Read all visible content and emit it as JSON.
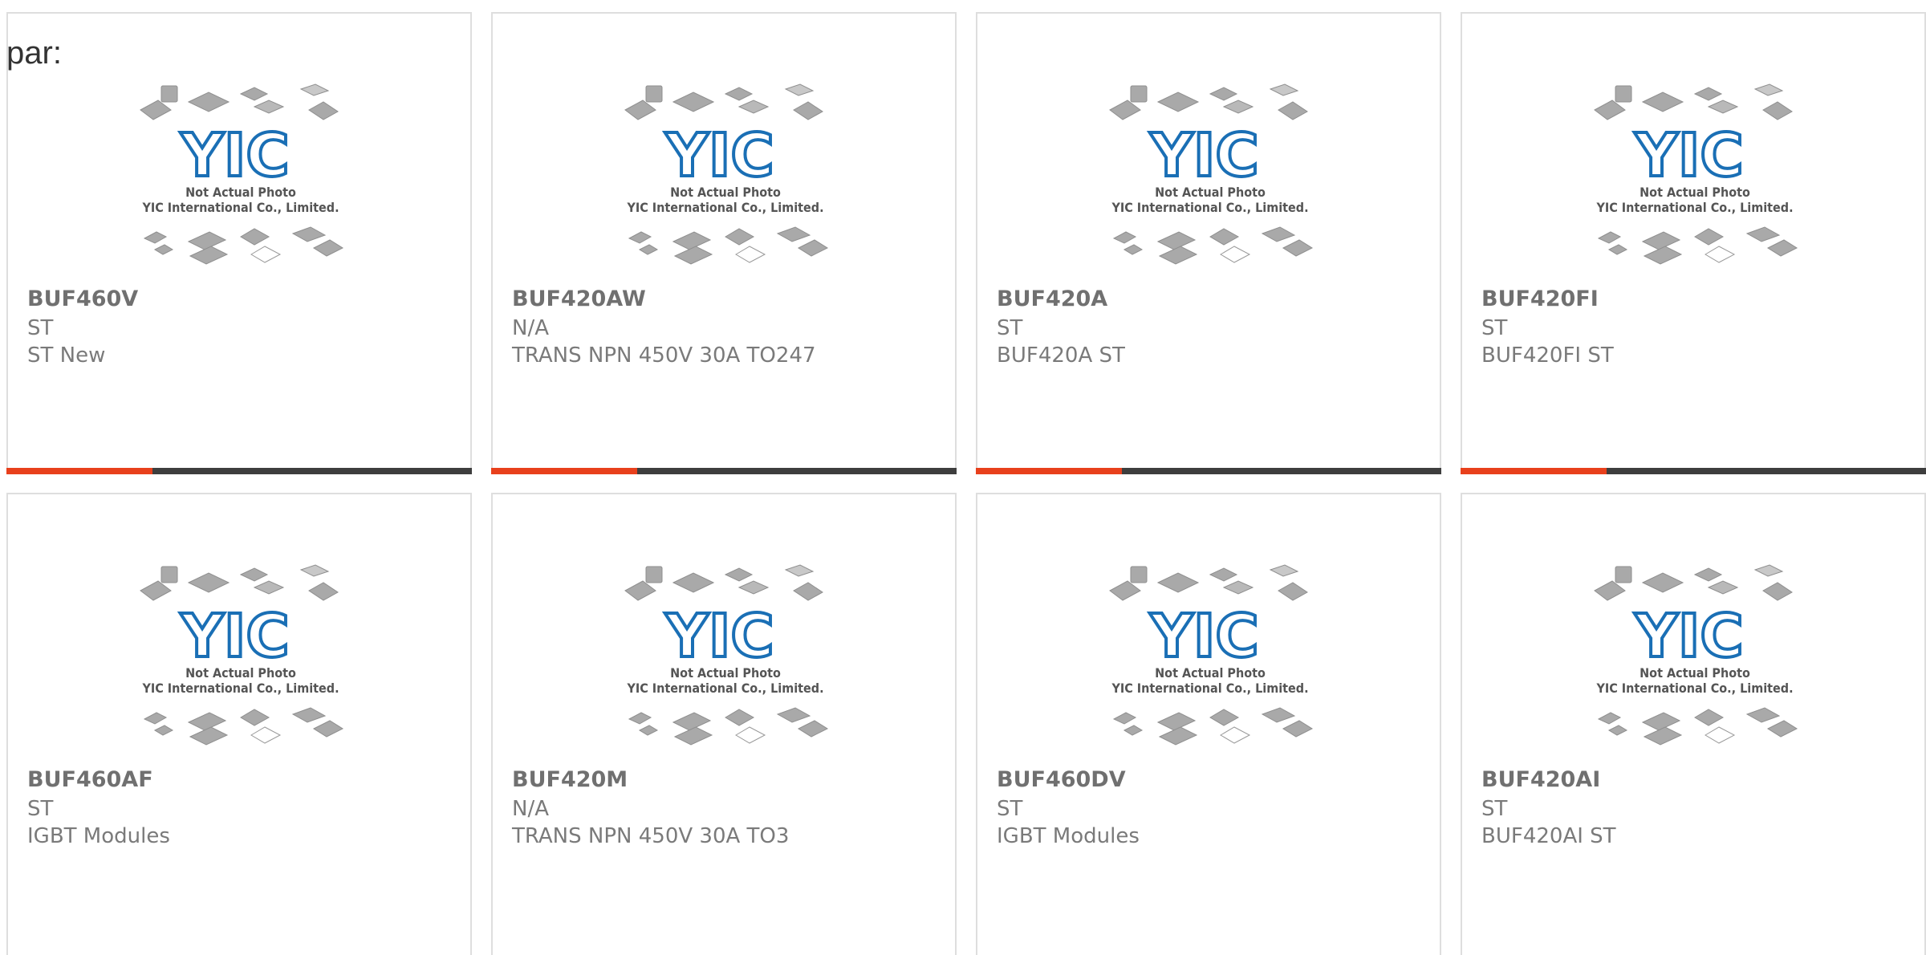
{
  "page_label": "par:",
  "products": [
    {
      "part": "BUF460V",
      "manufacturer": "ST",
      "description": "ST New"
    },
    {
      "part": "BUF420AW",
      "manufacturer": "N/A",
      "description": "TRANS NPN 450V 30A TO247"
    },
    {
      "part": "BUF420A",
      "manufacturer": "ST",
      "description": "BUF420A ST"
    },
    {
      "part": "BUF420FI",
      "manufacturer": "ST",
      "description": "BUF420FI ST"
    },
    {
      "part": "BUF460AF",
      "manufacturer": "ST",
      "description": "IGBT Modules"
    },
    {
      "part": "BUF420M",
      "manufacturer": "N/A",
      "description": "TRANS NPN 450V 30A TO3"
    },
    {
      "part": "BUF460DV",
      "manufacturer": "ST",
      "description": "IGBT Modules"
    },
    {
      "part": "BUF420AI",
      "manufacturer": "ST",
      "description": "BUF420AI ST"
    }
  ],
  "placeholder_image": {
    "logo_text": "YIC",
    "line1": "Not Actual Photo",
    "line2": "YIC International Co., Limited."
  },
  "colors": {
    "accent": "#e8401c",
    "bar": "#3e3e3e",
    "logo": "#1a6fb5"
  }
}
